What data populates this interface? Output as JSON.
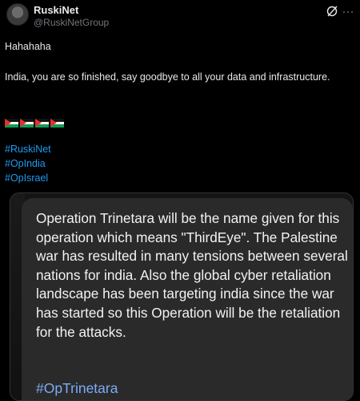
{
  "author": {
    "name": "RuskiNet",
    "handle": "@RuskiNetGroup"
  },
  "post": {
    "line1": "Hahahaha",
    "line2": "India, you are so finished, say goodbye to all your data and infrastructure.",
    "flags_count_label": "4 Palestine flags",
    "hashtags": [
      "#RuskiNet",
      "#OpIndia",
      "#OpIsrael"
    ]
  },
  "media": {
    "body": "Operation Trinetara will be the name given for this operation which means \"ThirdEye\". The Palestine war has resulted in many tensions between several nations for india. Also the global cyber retaliation landscape has been targeting india since the war has started so this Operation will be the retaliation for the attacks.",
    "hashtag": "#OpTrinetara"
  },
  "colors": {
    "background": "#000000",
    "link": "#1d9bf0",
    "panel": "#2a2a2a",
    "panel_link": "#7cacf8"
  },
  "icons": [
    "grok-icon",
    "more-icon",
    "palestine-flag-icon"
  ]
}
